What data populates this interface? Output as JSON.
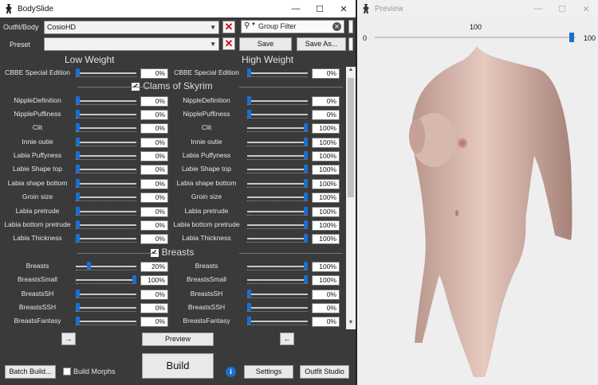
{
  "main_window": {
    "title": "BodySlide",
    "outfit_label": "Outfit/Body",
    "outfit_value": "CosioHD",
    "preset_label": "Preset",
    "preset_value": "",
    "group_filter_placeholder": "Group Filter",
    "save_label": "Save",
    "save_as_label": "Save As...",
    "low_weight_header": "Low Weight",
    "high_weight_header": "High Weight",
    "preview_button": "Preview",
    "left_arrow_button": "→",
    "right_arrow_button": "←",
    "batch_build_button": "Batch Build...",
    "build_morphs_label": "Build Morphs",
    "build_button": "Build",
    "settings_button": "Settings",
    "outfit_studio_button": "Outfit Studio",
    "info_icon_text": "i"
  },
  "sliders": [
    {
      "type": "slider",
      "low_name": "CBBE Special Edition",
      "high_name": "CBBE Special Edition",
      "low": 0,
      "high": 0,
      "low_text": "0%",
      "high_text": "0%"
    },
    {
      "type": "category",
      "label": "Clams of Skyrim",
      "checked": true
    },
    {
      "type": "slider",
      "low_name": "NippleDefinition",
      "high_name": "NippleDefinition",
      "low": 0,
      "high": 0,
      "low_text": "0%",
      "high_text": "0%"
    },
    {
      "type": "slider",
      "low_name": "NipplePuffiness",
      "high_name": "NipplePuffiness",
      "low": 0,
      "high": 0,
      "low_text": "0%",
      "high_text": "0%"
    },
    {
      "type": "slider",
      "low_name": "Clit",
      "high_name": "Clit",
      "low": 0,
      "high": 100,
      "low_text": "0%",
      "high_text": "100%"
    },
    {
      "type": "slider",
      "low_name": "Innie outie",
      "high_name": "Innie outie",
      "low": 0,
      "high": 100,
      "low_text": "0%",
      "high_text": "100%"
    },
    {
      "type": "slider",
      "low_name": "Labia Puffyness",
      "high_name": "Labia Puffyness",
      "low": 0,
      "high": 100,
      "low_text": "0%",
      "high_text": "100%"
    },
    {
      "type": "slider",
      "low_name": "Labie Shape top",
      "high_name": "Labie Shape top",
      "low": 0,
      "high": 100,
      "low_text": "0%",
      "high_text": "100%"
    },
    {
      "type": "slider",
      "low_name": "Labia shape bottom",
      "high_name": "Labia shape bottom",
      "low": 0,
      "high": 100,
      "low_text": "0%",
      "high_text": "100%"
    },
    {
      "type": "slider",
      "low_name": "Groin size",
      "high_name": "Groin size",
      "low": 0,
      "high": 100,
      "low_text": "0%",
      "high_text": "100%"
    },
    {
      "type": "slider",
      "low_name": "Labia pretrude",
      "high_name": "Labia pretrude",
      "low": 0,
      "high": 100,
      "low_text": "0%",
      "high_text": "100%"
    },
    {
      "type": "slider",
      "low_name": "Labia bottom pretrude",
      "high_name": "Labia bottom pretrude",
      "low": 0,
      "high": 100,
      "low_text": "0%",
      "high_text": "100%"
    },
    {
      "type": "slider",
      "low_name": "Labia Thickness",
      "high_name": "Labia Thickness",
      "low": 0,
      "high": 100,
      "low_text": "0%",
      "high_text": "100%"
    },
    {
      "type": "category",
      "label": "Breasts",
      "checked": true
    },
    {
      "type": "slider",
      "low_name": "Breasts",
      "high_name": "Breasts",
      "low": 20,
      "high": 100,
      "low_text": "20%",
      "high_text": "100%"
    },
    {
      "type": "slider",
      "low_name": "BreastsSmall",
      "high_name": "BreastsSmall",
      "low": 100,
      "high": 100,
      "low_text": "100%",
      "high_text": "100%"
    },
    {
      "type": "slider",
      "low_name": "BreastsSH",
      "high_name": "BreastsSH",
      "low": 0,
      "high": 0,
      "low_text": "0%",
      "high_text": "0%"
    },
    {
      "type": "slider",
      "low_name": "BreastsSSH",
      "high_name": "BreastsSSH",
      "low": 0,
      "high": 0,
      "low_text": "0%",
      "high_text": "0%"
    },
    {
      "type": "slider",
      "low_name": "BreastsFantasy",
      "high_name": "BreastsFantasy",
      "low": 0,
      "high": 0,
      "low_text": "0%",
      "high_text": "0%"
    }
  ],
  "preview_window": {
    "title": "Preview",
    "weight_min": "0",
    "weight_value": "100",
    "weight_max": "100",
    "weight": 100
  },
  "colors": {
    "accent": "#1a6fd1",
    "panel": "#3a3a3a",
    "clear_red": "#d01010",
    "skin": "#d9b3a8"
  }
}
